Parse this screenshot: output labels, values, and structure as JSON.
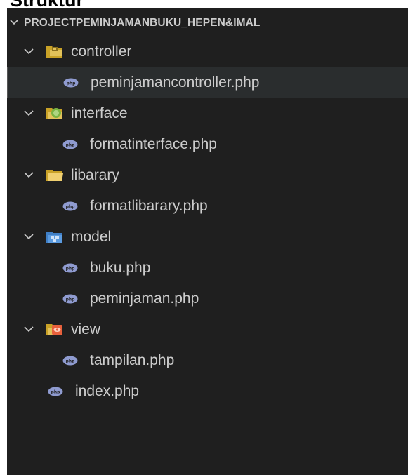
{
  "caption": "Struktur",
  "explorer": {
    "root_label": "PROJECTPEMINJAMANBUKU_HEPEN&IMAL",
    "items": [
      {
        "label": "controller",
        "type": "folder",
        "icon": "controller-folder-icon",
        "color": "#c9a227"
      },
      {
        "label": "peminjamancontroller.php",
        "type": "file",
        "icon": "php-file-icon",
        "selected": true
      },
      {
        "label": "interface",
        "type": "folder",
        "icon": "interface-folder-icon",
        "color": "#8bc34a"
      },
      {
        "label": "formatinterface.php",
        "type": "file",
        "icon": "php-file-icon"
      },
      {
        "label": "libarary",
        "type": "folder",
        "icon": "library-folder-icon",
        "color": "#e6c45a"
      },
      {
        "label": "formatlibarary.php",
        "type": "file",
        "icon": "php-file-icon"
      },
      {
        "label": "model",
        "type": "folder",
        "icon": "model-folder-icon",
        "color": "#4a8fd8"
      },
      {
        "label": "buku.php",
        "type": "file",
        "icon": "php-file-icon"
      },
      {
        "label": "peminjaman.php",
        "type": "file",
        "icon": "php-file-icon"
      },
      {
        "label": "view",
        "type": "folder",
        "icon": "view-folder-icon",
        "color": "#e8603c"
      },
      {
        "label": "tampilan.php",
        "type": "file",
        "icon": "php-file-icon"
      },
      {
        "label": "index.php",
        "type": "file",
        "icon": "php-file-icon"
      }
    ]
  },
  "colors": {
    "background": "#1f1f1f",
    "text": "#cccccc",
    "selected_row": "#2a2d2e",
    "php_icon": "#8f9bd0"
  }
}
